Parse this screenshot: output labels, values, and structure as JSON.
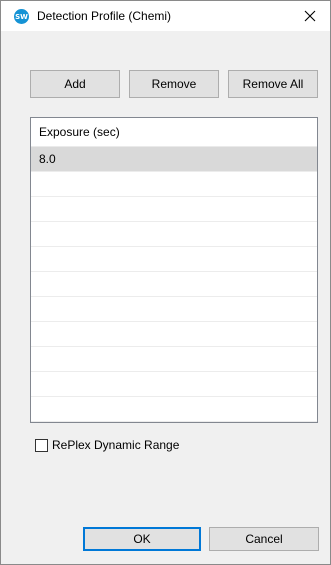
{
  "window": {
    "title": "Detection Profile (Chemi)",
    "app_icon_text": "SW",
    "close_glyph": "✕"
  },
  "toolbar": {
    "add_label": "Add",
    "remove_label": "Remove",
    "remove_all_label": "Remove All"
  },
  "table": {
    "header": "Exposure (sec)",
    "rows": [
      "8.0",
      "",
      "",
      "",
      "",
      "",
      "",
      "",
      "",
      "",
      ""
    ],
    "selected_row": 0
  },
  "options": {
    "replex_label": "RePlex Dynamic Range",
    "replex_checked": false
  },
  "footer": {
    "ok_label": "OK",
    "cancel_label": "Cancel"
  },
  "colors": {
    "accent": "#0078d7",
    "app_icon": "#1593d5",
    "selection": "#d9d9d9"
  }
}
